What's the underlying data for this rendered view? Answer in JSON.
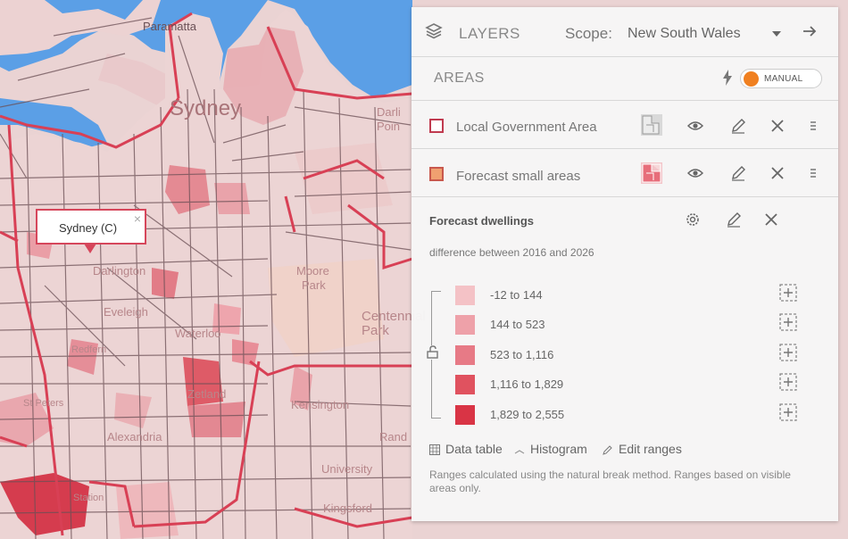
{
  "map": {
    "labels": {
      "sydney": "Sydney",
      "paramatta": "Paramatta",
      "darling_point_1": "Darli",
      "darling_point_2": "Poin",
      "moore_park_1": "Moore",
      "moore_park_2": "Park",
      "centennial_1": "Centennial",
      "centennial_2": "Park",
      "kensington": "Kensington",
      "alexandria": "Alexandria",
      "zetland": "Zetland",
      "waterloo": "Waterloo",
      "kingsford": "Kingsford",
      "randwick": "Rand",
      "university": "University",
      "st_peters_1": "St Peters",
      "darlington": "Darlington",
      "eveleigh": "Eveleigh",
      "redfern": "Redfern",
      "station": "Station"
    },
    "colors": {
      "water": "#5b9fe6",
      "land": "#ead4d4",
      "boundary": "#d84055",
      "street": "#6b4f55"
    }
  },
  "popup": {
    "text": "Sydney (C)",
    "close": "×"
  },
  "panel": {
    "header": {
      "title": "LAYERS",
      "scope_label": "Scope:",
      "scope_value": "New South Wales"
    },
    "areas": {
      "title": "AREAS",
      "toggle_label": "MANUAL",
      "toggle_color": "#f08020"
    },
    "layers": [
      {
        "name": "Local Government Area",
        "swatch_border": "#c03a4f",
        "swatch_fill": "#ffffff"
      },
      {
        "name": "Forecast small areas",
        "swatch_border": "#c8584d",
        "swatch_fill": "#f0a070"
      }
    ],
    "forecast": {
      "title": "Forecast dwellings",
      "subtitle": "difference between 2016 and 2026",
      "legend": [
        {
          "label": "-12 to 144",
          "color": "#f4c2c6"
        },
        {
          "label": "144 to 523",
          "color": "#eea1a9"
        },
        {
          "label": "523 to 1,116",
          "color": "#e77a86"
        },
        {
          "label": "1,116 to 1,829",
          "color": "#e0525f"
        },
        {
          "label": "1,829 to 2,555",
          "color": "#d93445"
        }
      ],
      "footer": {
        "data_table": "Data table",
        "histogram": "Histogram",
        "edit_ranges": "Edit ranges"
      },
      "note": "Ranges calculated using the natural break method. Ranges based on visible areas only."
    }
  }
}
